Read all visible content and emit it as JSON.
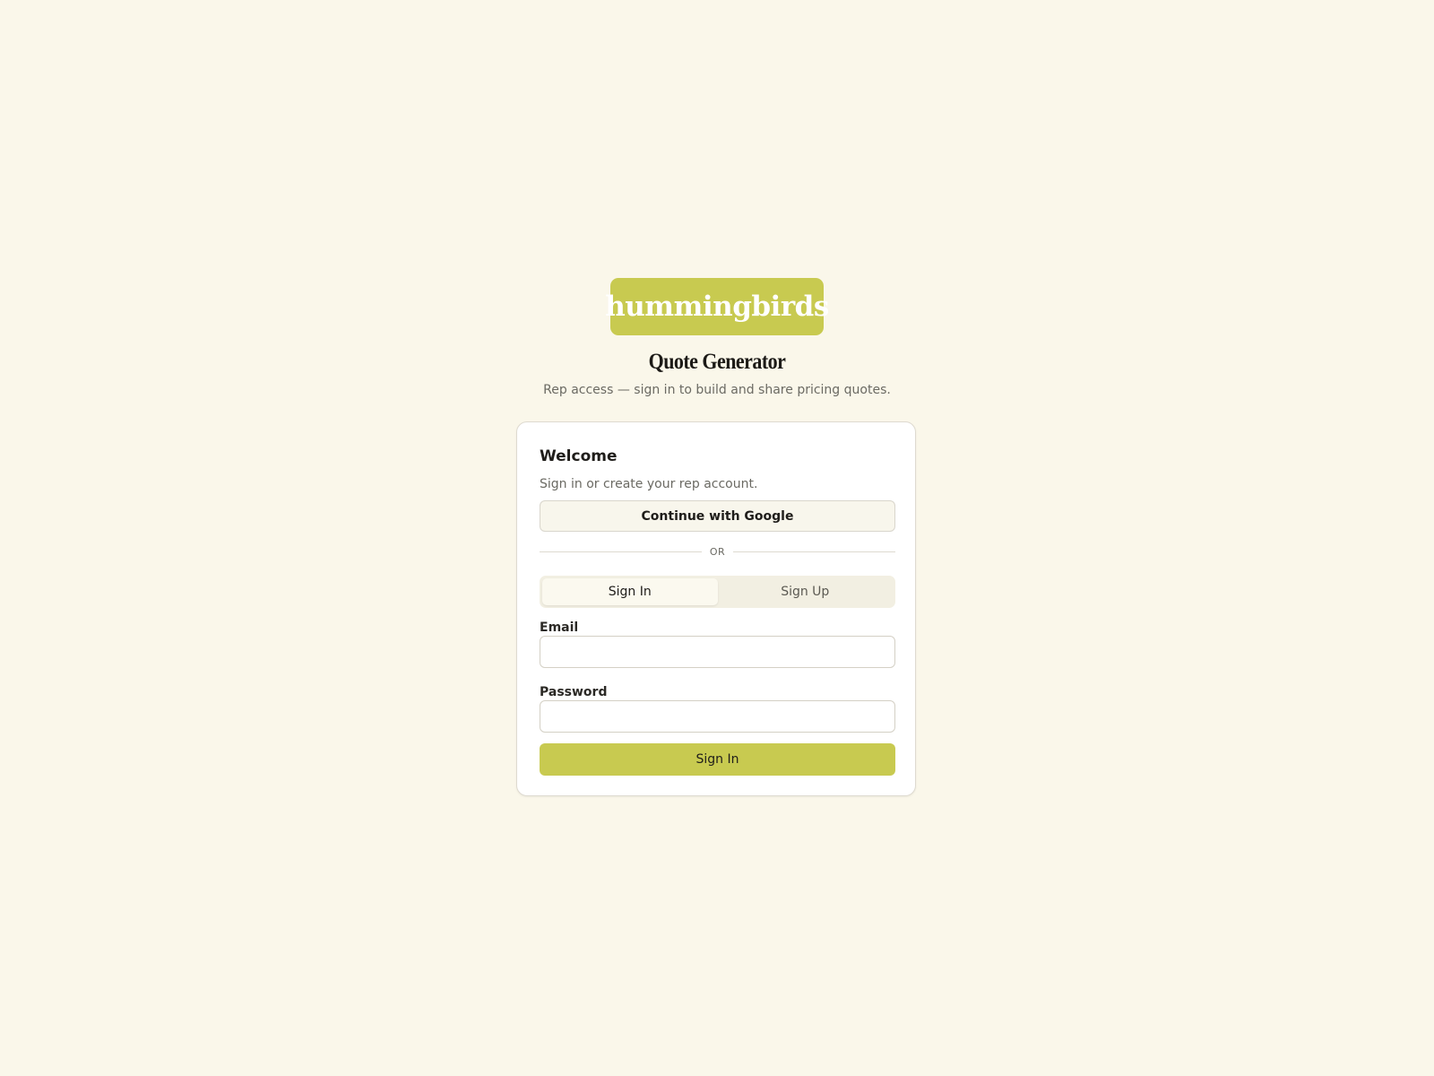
{
  "brand": {
    "logo_text": "hummingbirds",
    "accent_color": "#c8ca50",
    "background_color": "#faf7ea"
  },
  "header": {
    "title": "Quote Generator",
    "subtitle": "Rep access — sign in to build and share pricing quotes."
  },
  "auth_card": {
    "title": "Welcome",
    "subtitle": "Sign in or create your rep account.",
    "google_button_label": "Continue with Google",
    "divider_text": "OR",
    "tabs": [
      {
        "label": "Sign In",
        "active": true
      },
      {
        "label": "Sign Up",
        "active": false
      }
    ],
    "email": {
      "label": "Email",
      "value": "",
      "placeholder": ""
    },
    "password": {
      "label": "Password",
      "value": "",
      "placeholder": ""
    },
    "submit_label": "Sign In"
  }
}
